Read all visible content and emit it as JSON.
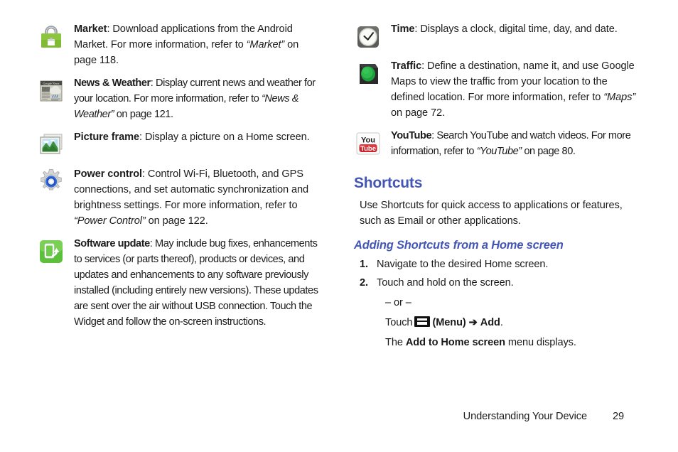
{
  "document": {
    "footer_section": "Understanding Your Device",
    "footer_page_number": "29"
  },
  "colors": {
    "heading": "#4356b5",
    "body_text": "#1b1b1b",
    "market_green": "#8cc63f",
    "software_green": "#5cc03c",
    "traffic_green": "#22aa44",
    "youtube_red": "#cc2229"
  },
  "left_column": {
    "entries": [
      {
        "icon": "android-market-icon",
        "term": "Market",
        "body_1": ": Download applications from the Android Market. For more information, refer to ",
        "italic_1": "“Market”",
        "body_2": " on page 118."
      },
      {
        "icon": "news-and-weather-icon",
        "term": "News & Weather",
        "body_1": ": Display current news and weather for your location. For more information, refer to ",
        "italic_1": "“News & Weather”",
        "body_2": " on page 121."
      },
      {
        "icon": "picture-frame-icon",
        "term": "Picture frame",
        "body_1": ": Display a picture on a Home screen.",
        "italic_1": "",
        "body_2": ""
      },
      {
        "icon": "power-control-icon",
        "term": "Power control",
        "body_1": ": Control Wi-Fi, Bluetooth, and GPS connections, and set automatic synchronization and brightness settings. For more information, refer to ",
        "italic_1": "“Power Control”",
        "body_2": " on page 122."
      },
      {
        "icon": "software-update-icon",
        "term": "Software update",
        "body_1": ": May include bug fixes, enhancements to services (or parts thereof), products or devices, and updates and enhancements to any software previously installed (including entirely new versions). These updates are sent over the air without USB connection. Touch the Widget and follow the on-screen instructions.",
        "italic_1": "",
        "body_2": ""
      }
    ]
  },
  "right_column": {
    "entries": [
      {
        "icon": "time-clock-icon",
        "term": "Time",
        "body_1": ": Displays a clock, digital time, day, and date.",
        "italic_1": "",
        "body_2": ""
      },
      {
        "icon": "traffic-light-icon",
        "term": "Traffic",
        "body_1": ": Define a destination, name it, and use Google Maps to view the traffic from your location to the defined location. For more information, refer to ",
        "italic_1": "“Maps”",
        "body_2": " on page 72."
      },
      {
        "icon": "youtube-icon",
        "term": "YouTube",
        "body_1": ": Search YouTube and watch videos. For more information, refer to ",
        "italic_1": "“YouTube”",
        "body_2": " on page 80."
      }
    ],
    "section": {
      "heading": "Shortcuts",
      "intro": "Use Shortcuts for quick access to applications or features, such as Email or other applications.",
      "subheading": "Adding Shortcuts from a Home screen",
      "steps": [
        {
          "number": "1.",
          "text": "Navigate to the desired Home screen."
        },
        {
          "number": "2.",
          "text": "Touch and hold on the screen."
        }
      ],
      "or_separator": "– or –",
      "touch_label": "Touch",
      "menu_icon_name": "menu-icon",
      "menu_label": "(Menu)",
      "arrow": "➔",
      "add_label": "Add",
      "add_period": ".",
      "result_prefix": "The ",
      "result_bold": "Add to Home screen",
      "result_suffix": " menu displays."
    }
  }
}
